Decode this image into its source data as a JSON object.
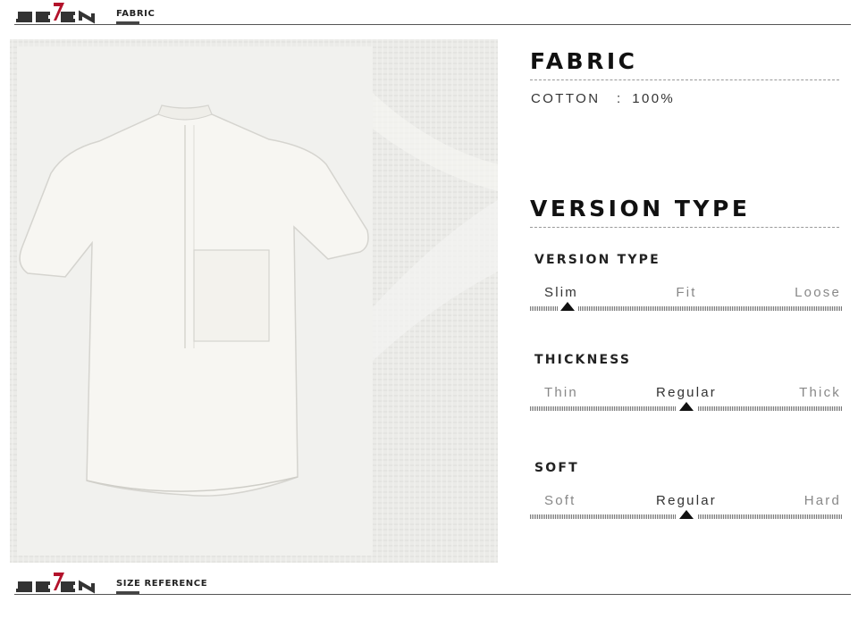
{
  "header": {
    "section_label": "FABRIC"
  },
  "footer": {
    "section_label": "SIZE REFERENCE"
  },
  "brand": {
    "logo_icon": "seven-logo",
    "accent_color": "#b3122b"
  },
  "fabric": {
    "heading": "FABRIC",
    "material": "COTTON",
    "separator": ":",
    "percentage": "100%"
  },
  "version": {
    "heading": "VERSION TYPE",
    "attributes": [
      {
        "title": "VERSION TYPE",
        "options": [
          "Slim",
          "Fit",
          "Loose"
        ],
        "selected_index": 0,
        "marker_position": 0.12
      },
      {
        "title": "THICKNESS",
        "options": [
          "Thin",
          "Regular",
          "Thick"
        ],
        "selected_index": 1,
        "marker_position": 0.5
      },
      {
        "title": "SOFT",
        "options": [
          "Soft",
          "Regular",
          "Hard"
        ],
        "selected_index": 1,
        "marker_position": 0.5
      }
    ]
  },
  "colors": {
    "heading": "#111111",
    "label_muted": "#888888",
    "label_active": "#333333",
    "marker": "#111111",
    "fabric_bg": "#ececea",
    "shirt": "#f4f3ef"
  }
}
